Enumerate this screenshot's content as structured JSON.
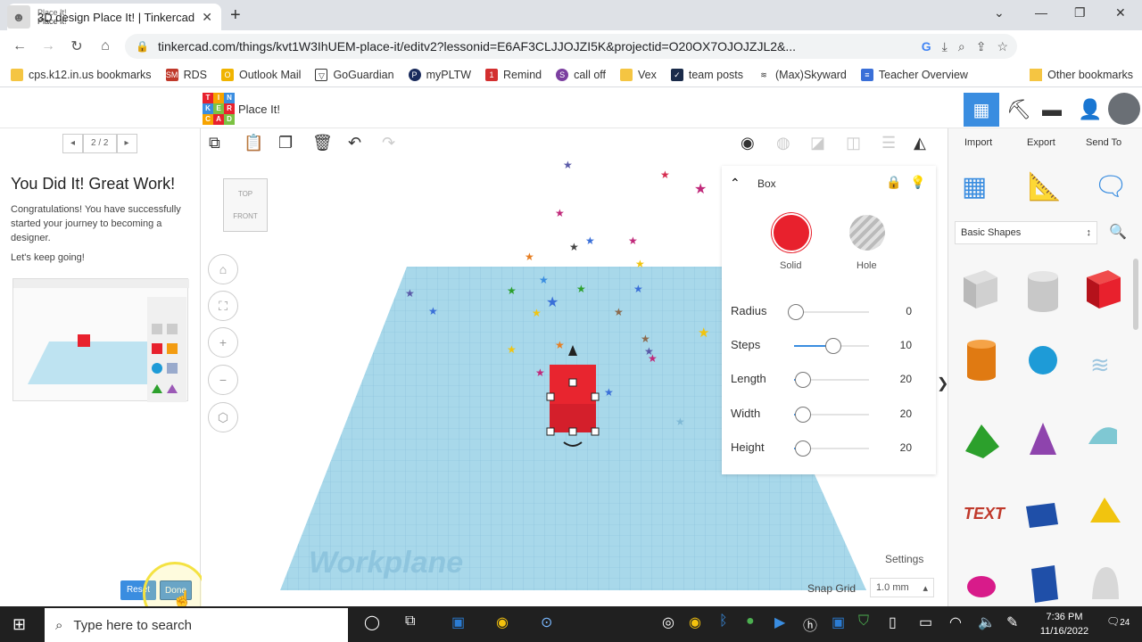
{
  "browser": {
    "tab_title": "3D design Place It! | Tinkercad",
    "url": "tinkercad.com/things/kvt1W3IhUEM-place-it/editv2?lessonid=E6AF3CLJJOJZI5K&projectid=O20OX7OJOJZJL2&...",
    "bookmarks": [
      "cps.k12.in.us bookmarks",
      "RDS",
      "Outlook Mail",
      "GoGuardian",
      "myPLTW",
      "Remind",
      "call off",
      "Vex",
      "team posts",
      "(Max)Skyward",
      "Teacher Overview"
    ],
    "other_bookmarks": "Other bookmarks"
  },
  "tinkercad": {
    "lesson_tab_line1": "Place It!",
    "lesson_tab_line2": "Place It!",
    "design_title": "Place It!",
    "logo_letters": [
      "T",
      "I",
      "N",
      "K",
      "E",
      "R",
      "C",
      "A",
      "D"
    ],
    "pager": "2 / 2",
    "lesson_title": "You Did It! Great Work!",
    "lesson_body": "Congratulations! You have successfully started your journey to becoming a designer.",
    "lesson_body2": "Let's keep going!",
    "reset_label": "Reset",
    "done_label": "Done",
    "viewcube_top": "TOP",
    "viewcube_front": "FRONT",
    "workplane_label": "Workplane",
    "settings_label": "Settings",
    "snap_label": "Snap Grid",
    "snap_value": "1.0 mm",
    "inspector": {
      "title": "Box",
      "solid_label": "Solid",
      "hole_label": "Hole",
      "props": [
        {
          "label": "Radius",
          "value": "0",
          "fraction": 0.0
        },
        {
          "label": "Steps",
          "value": "10",
          "fraction": 0.5
        },
        {
          "label": "Length",
          "value": "20",
          "fraction": 0.1
        },
        {
          "label": "Width",
          "value": "20",
          "fraction": 0.1
        },
        {
          "label": "Height",
          "value": "20",
          "fraction": 0.1
        }
      ]
    },
    "actions": {
      "import": "Import",
      "export": "Export",
      "send_to": "Send To"
    },
    "shape_category": "Basic Shapes"
  },
  "taskbar": {
    "search_placeholder": "Type here to search",
    "time": "7:36 PM",
    "date": "11/16/2022",
    "notifications": "24"
  },
  "colors": {
    "accent": "#3a8de0",
    "box_red": "#e8212d",
    "grid_blue": "#a8d8ea"
  }
}
